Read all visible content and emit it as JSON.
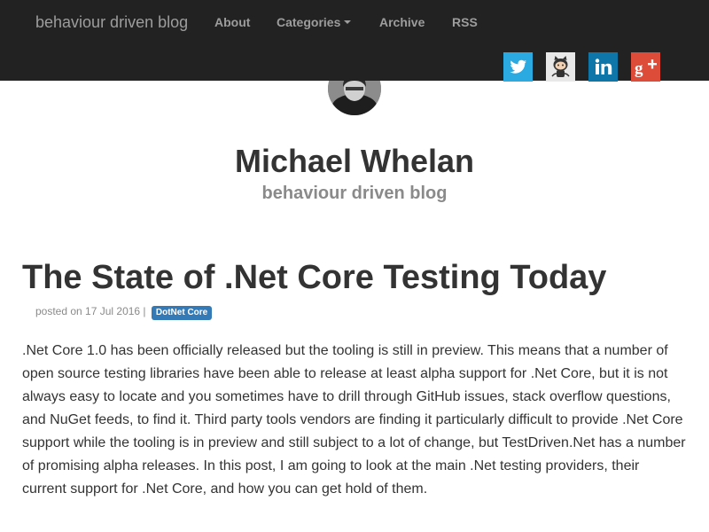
{
  "navbar": {
    "brand": "behaviour driven blog",
    "items": [
      {
        "label": "About"
      },
      {
        "label": "Categories"
      },
      {
        "label": "Archive"
      },
      {
        "label": "RSS"
      }
    ],
    "background_color": "#222222",
    "social_icons": [
      "twitter-icon",
      "github-icon",
      "linkedin-icon",
      "google-plus-icon"
    ]
  },
  "header": {
    "title": "Michael Whelan",
    "subtitle": "behaviour driven blog"
  },
  "post": {
    "title": "The State of .Net Core Testing Today",
    "meta_prefix": "posted on 17 Jul 2016 |",
    "tag": "DotNet Core",
    "tag_color": "#337ab7",
    "body": ".Net Core 1.0 has been officially released but the tooling is still in preview. This means that a number of open source testing libraries have been able to release at least alpha support for .Net Core, but it is not always easy to locate and you sometimes have to drill through GitHub issues, stack overflow questions, and NuGet feeds, to find it. Third party tools vendors are finding it particularly difficult to provide .Net Core support while the tooling is in preview and still subject to a lot of change, but TestDriven.Net has a number of promising alpha releases. In this post, I am going to look at the main .Net testing providers, their current support for .Net Core, and how you can get hold of them."
  }
}
